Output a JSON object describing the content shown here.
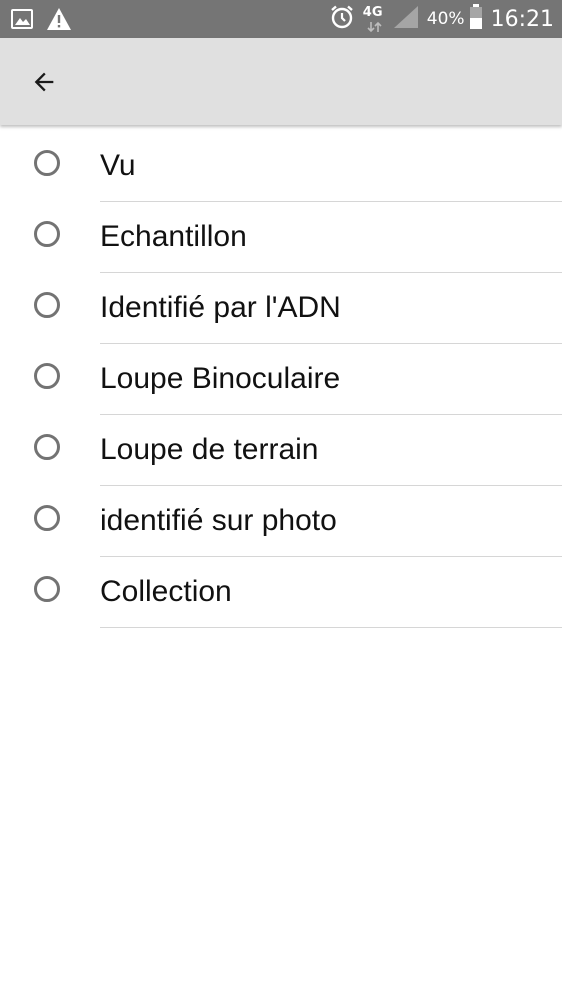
{
  "status_bar": {
    "left_icons": [
      "image-icon",
      "warning-icon"
    ],
    "network_label": "4G",
    "battery_percent": "40%",
    "time": "16:21",
    "bar_color": "#757575"
  },
  "app_bar": {
    "back_icon": "arrow-back-icon",
    "background": "#e0e0e0"
  },
  "options": [
    {
      "label": "Vu",
      "selected": false
    },
    {
      "label": "Echantillon",
      "selected": false
    },
    {
      "label": "Identifié par l'ADN",
      "selected": false
    },
    {
      "label": "Loupe Binoculaire",
      "selected": false
    },
    {
      "label": "Loupe de terrain",
      "selected": false
    },
    {
      "label": "identifié sur photo",
      "selected": false
    },
    {
      "label": "Collection",
      "selected": false
    }
  ]
}
